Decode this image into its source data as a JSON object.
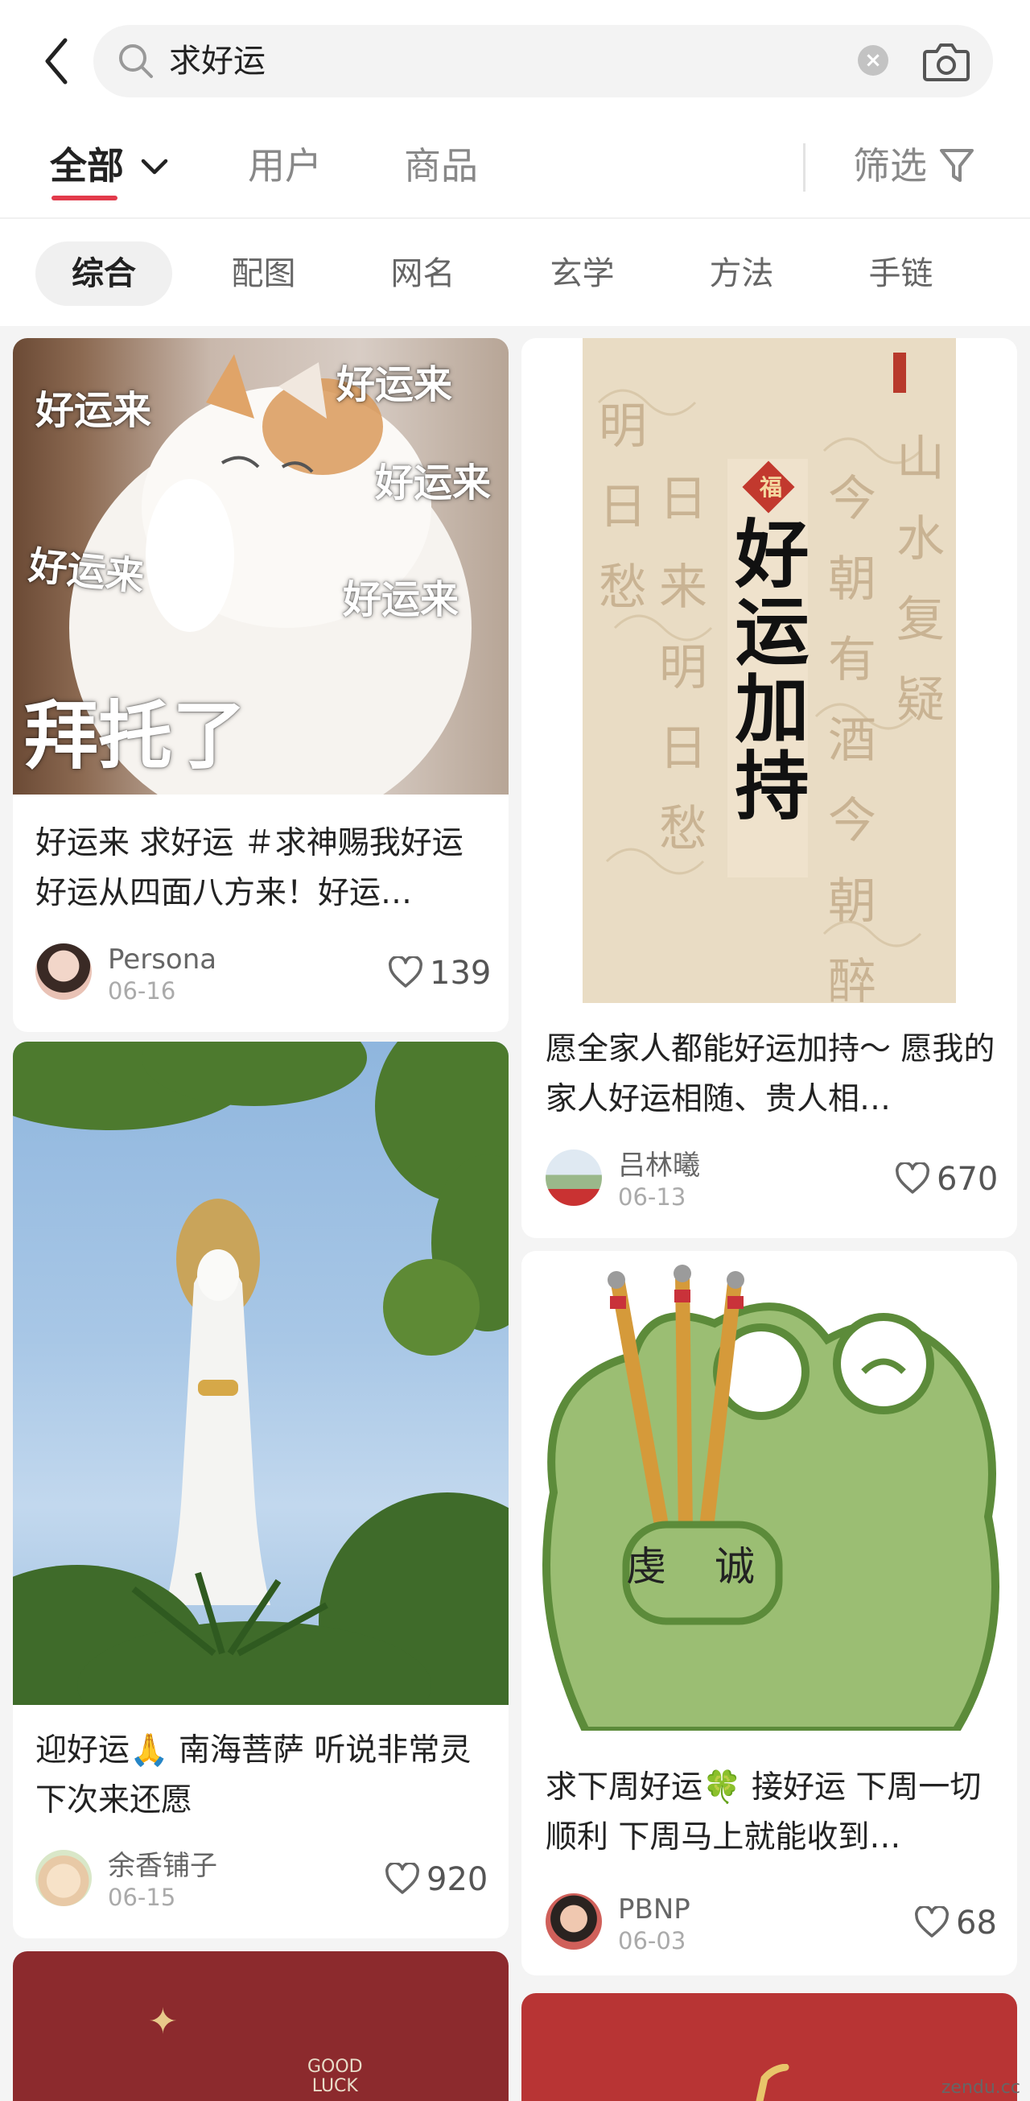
{
  "search": {
    "query": "求好运"
  },
  "tabs": [
    {
      "label": "全部"
    },
    {
      "label": "用户"
    },
    {
      "label": "商品"
    }
  ],
  "filter": {
    "label": "筛选"
  },
  "chips": [
    "综合",
    "配图",
    "网名",
    "玄学",
    "方法",
    "手链"
  ],
  "cards": [
    {
      "image_texts": [
        "好运来",
        "好运来",
        "好运来",
        "好运来",
        "好运来",
        "拜托了"
      ],
      "title": "好运来 求好运 ＃求神赐我好运好运从四面八方来！好运…",
      "author": "Persona",
      "date": "06-16",
      "likes": "139"
    },
    {
      "image_texts": [
        "好运加持"
      ],
      "title": "愿全家人都能好运加持～ 愿我的家人好运相随、贵人相…",
      "author": "吕林曦",
      "date": "06-13",
      "likes": "670"
    },
    {
      "title": "迎好运🙏 南海菩萨 听说非常灵 下次来还愿",
      "author": "余香铺子",
      "date": "06-15",
      "likes": "920"
    },
    {
      "image_texts": [
        "虔",
        "诚"
      ],
      "title": "求下周好运🍀 接好运 下周一切顺利 下周马上就能收到…",
      "author": "PBNP",
      "date": "06-03",
      "likes": "68"
    },
    {
      "image_texts": [
        "GOOD",
        "LUCK"
      ]
    }
  ],
  "watermark": "zendu.cc"
}
